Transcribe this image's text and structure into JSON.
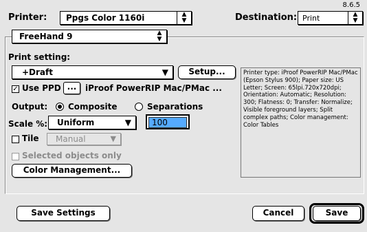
{
  "version": "8.6.5",
  "printer": {
    "label": "Printer:",
    "value": "Ppgs Color 1160i"
  },
  "destination": {
    "label": "Destination:",
    "value": "Print"
  },
  "app_section": {
    "value": "FreeHand 9"
  },
  "print_setting": {
    "label": "Print setting:",
    "value": "+Draft",
    "setup_label": "Setup..."
  },
  "use_ppd": {
    "label": "Use PPD",
    "checked": true,
    "browse_label": "...",
    "ppd_name": "iProof PowerRIP Mac/PMac ..."
  },
  "output": {
    "label": "Output:",
    "composite": "Composite",
    "separations": "Separations",
    "selected": "composite"
  },
  "scale": {
    "label": "Scale %:",
    "mode": "Uniform",
    "value": "100"
  },
  "tile": {
    "label": "Tile",
    "mode": "Manual"
  },
  "selected_only": {
    "label": "Selected objects only"
  },
  "color_management_label": "Color Management...",
  "summary_text": "Printer type: iProof PowerRIP Mac/PMac (Epson Stylus 900); Paper size: US Letter; Screen: 65lpi.720x720dpi; Orientation: Automatic; Resolution: 300; Flatness: 0; Transfer: Normalize; Visible foreground layers; Split complex paths; Color management: Color Tables",
  "footer": {
    "save_settings": "Save Settings",
    "cancel": "Cancel",
    "save": "Save"
  }
}
